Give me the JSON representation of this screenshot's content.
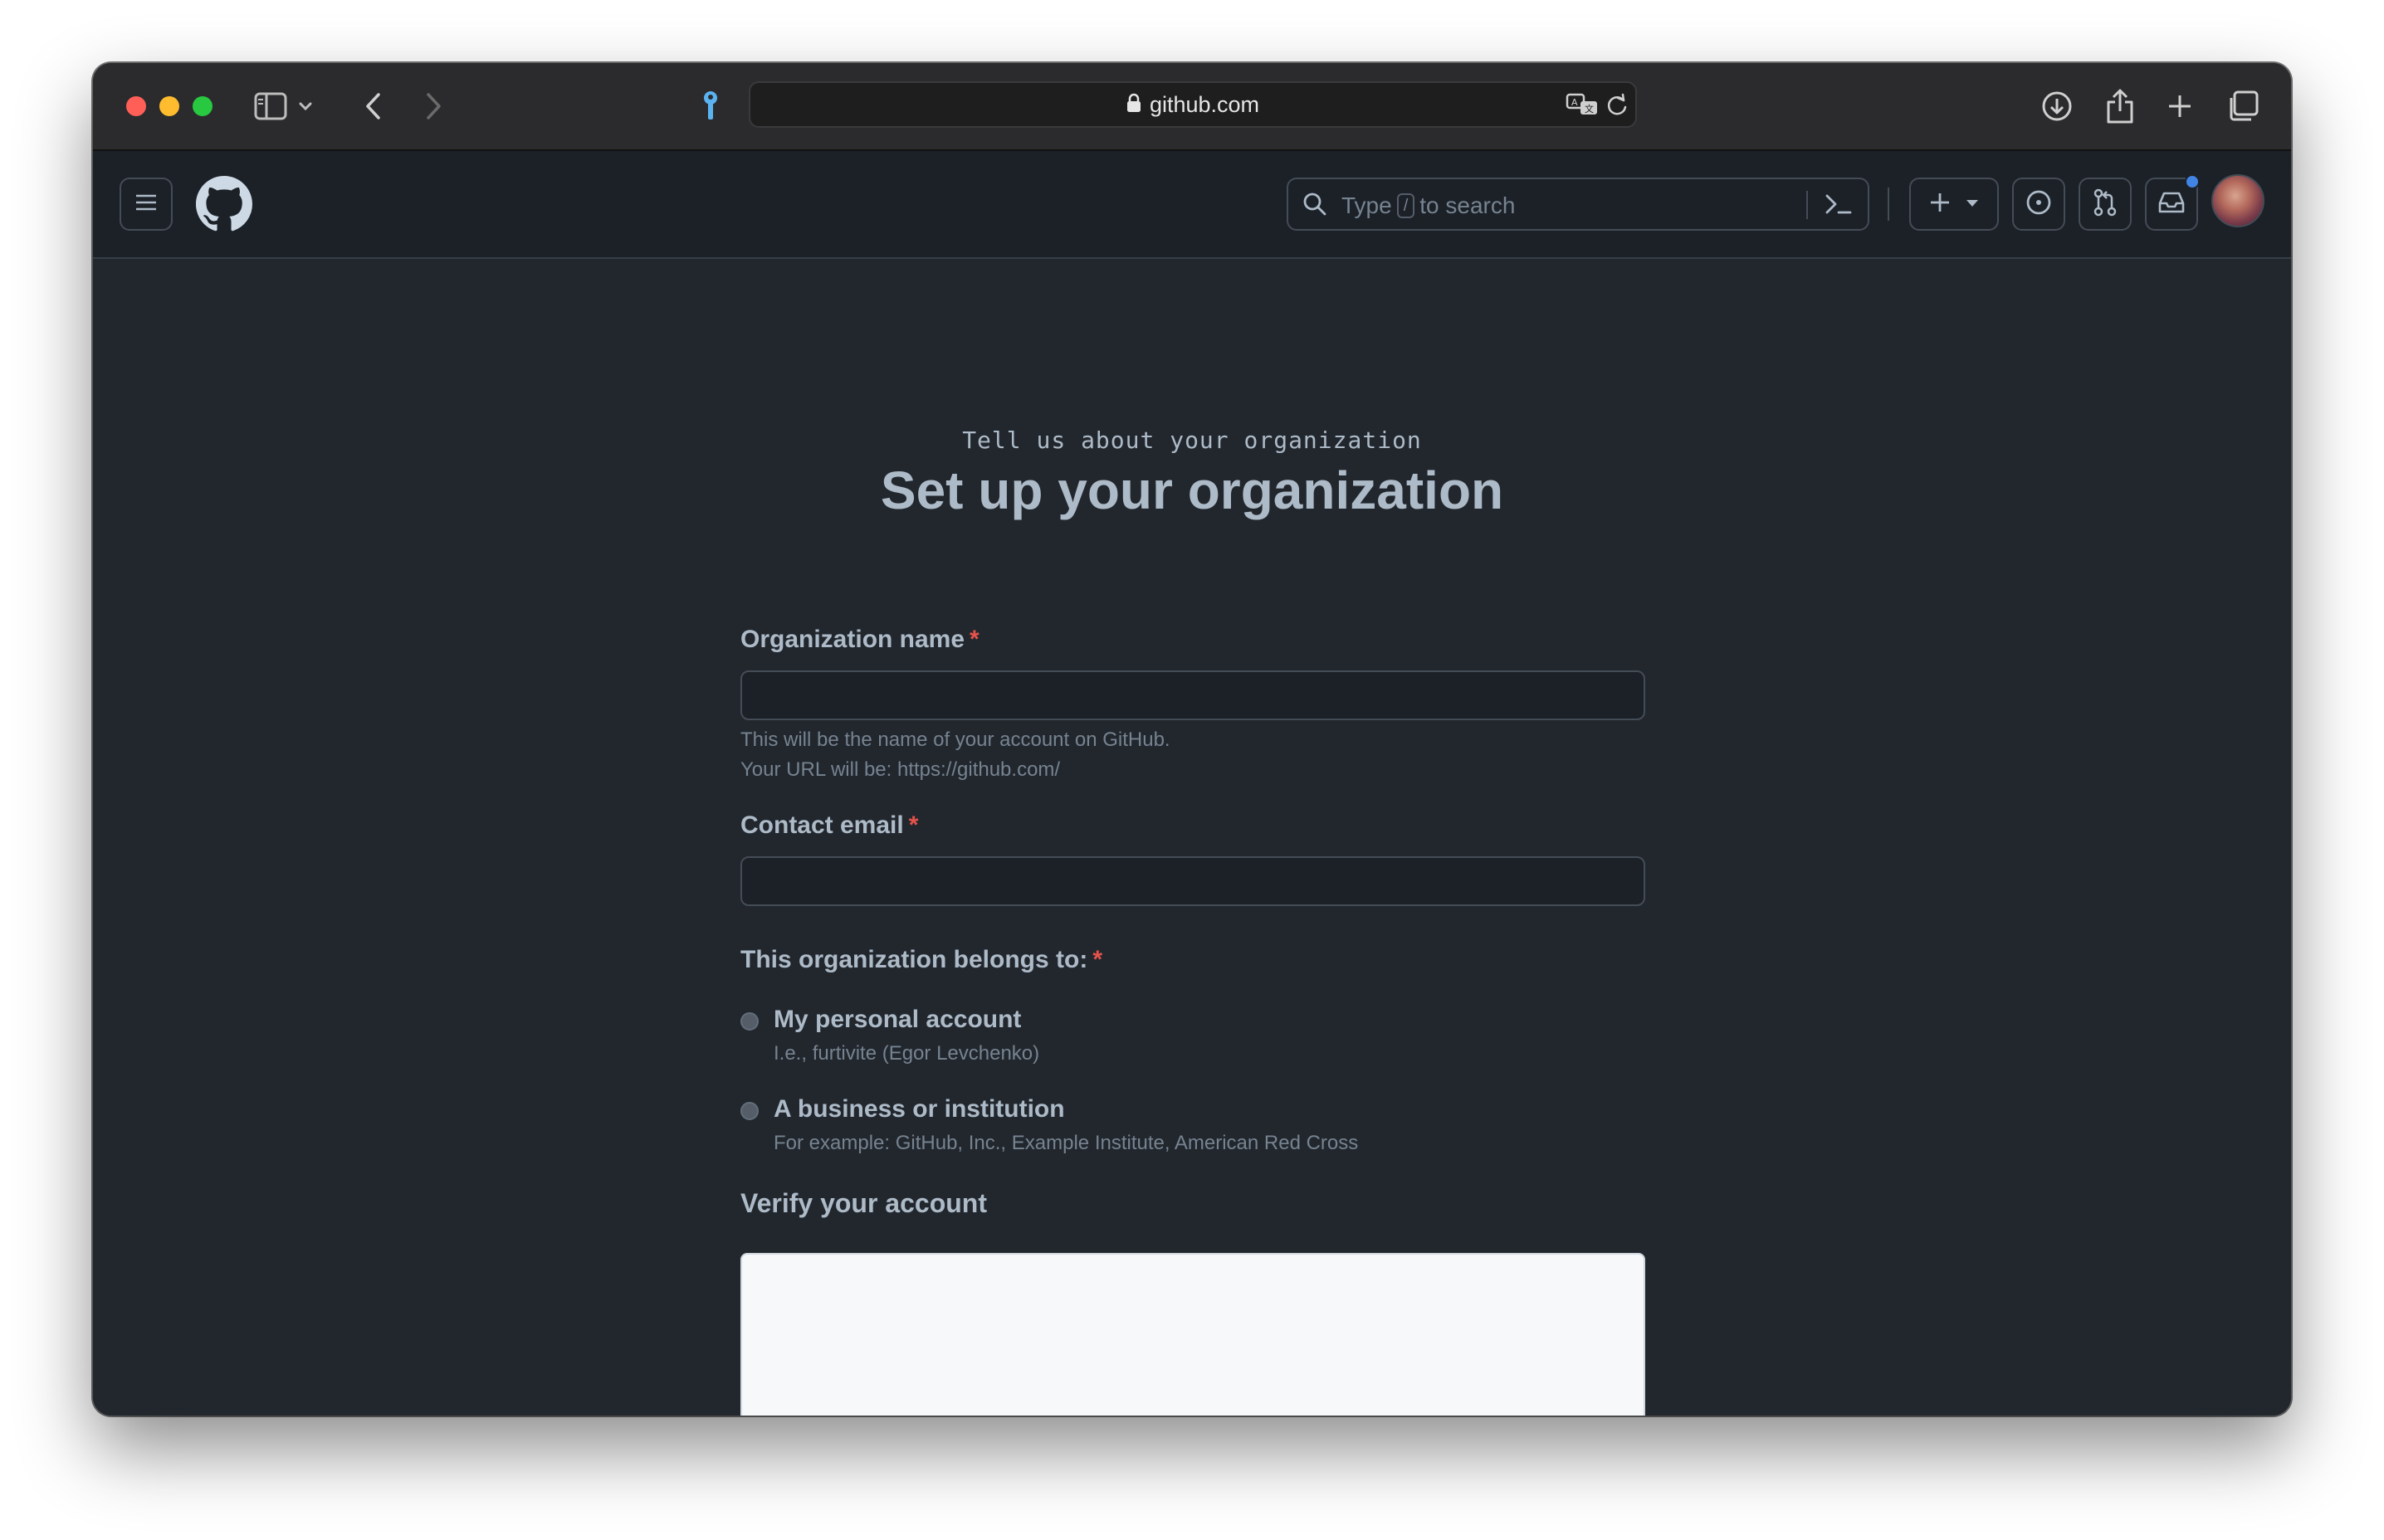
{
  "browser": {
    "url": "github.com",
    "icons": [
      "sidebar-icon",
      "chevron-down-icon",
      "back-icon",
      "forward-icon",
      "password-key-icon",
      "lock-icon",
      "translate-icon",
      "reload-icon",
      "download-icon",
      "share-icon",
      "new-tab-icon",
      "tab-overview-icon"
    ]
  },
  "header": {
    "search_prefix": "Type",
    "search_key": "/",
    "search_suffix": "to search",
    "icons": [
      "hamburger-icon",
      "github-logo-icon",
      "search-icon",
      "command-palette-icon",
      "plus-icon",
      "issues-icon",
      "pull-requests-icon",
      "inbox-icon"
    ]
  },
  "page": {
    "kicker": "Tell us about your organization",
    "title": "Set up your organization"
  },
  "form": {
    "org_name_label": "Organization name",
    "required_mark": "*",
    "org_name_value": "",
    "org_name_hint": "This will be the name of your account on GitHub.",
    "org_url_hint": "Your URL will be: https://github.com/",
    "email_label": "Contact email",
    "email_value": "",
    "belongs_label": "This organization belongs to:",
    "options": [
      {
        "label": "My personal account",
        "desc": "I.e., furtivite (Egor Levchenko)"
      },
      {
        "label": "A business or institution",
        "desc": "For example: GitHub, Inc., Example Institute, American Red Cross"
      }
    ],
    "verify_title": "Verify your account"
  },
  "colors": {
    "background": "#22272e",
    "header": "#1c2128",
    "text": "#adbac7",
    "muted": "#768390",
    "required": "#e5534b",
    "notification": "#4184e4"
  }
}
